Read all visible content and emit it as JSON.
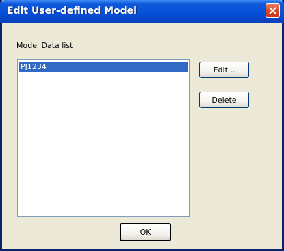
{
  "window": {
    "title": "Edit User-defined Model"
  },
  "dialog": {
    "list_label": "Model Data list",
    "items": [
      {
        "label": "PJ1234",
        "selected": true
      }
    ],
    "buttons": {
      "edit": "Edit...",
      "delete": "Delete",
      "ok": "OK"
    }
  },
  "icons": {
    "close": "close-icon"
  },
  "colors": {
    "titlebar": "#0550d8",
    "selection": "#316ac5",
    "dialog_bg": "#ece9d8",
    "close_button": "#d84e2a"
  }
}
